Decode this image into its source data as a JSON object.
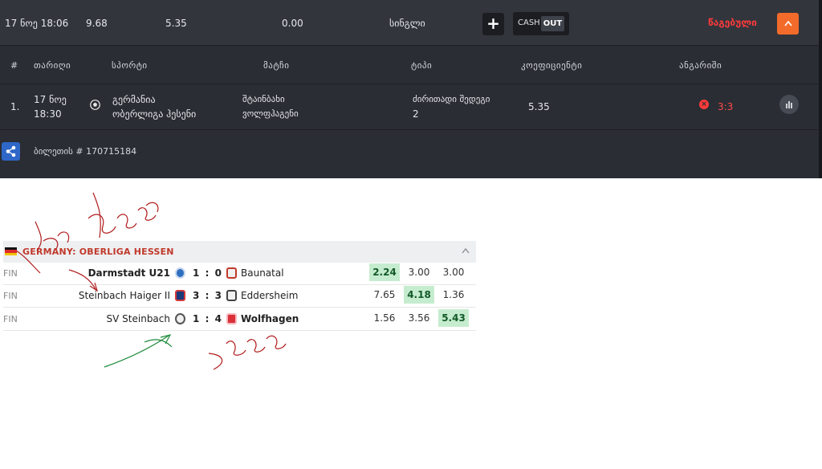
{
  "bet": {
    "summary": {
      "date": "17 ნოე 18:06",
      "stake": "9.68",
      "coefficient": "5.35",
      "payout": "0.00",
      "type": "სინგლი",
      "plus_label": "+",
      "cash_label": "CASH",
      "out_label": "OUT",
      "status": "წაგებული",
      "collapse_label": "^"
    },
    "columns": {
      "num": "#",
      "date": "თარიღი",
      "sport": "სპორტი",
      "match": "მატჩი",
      "type": "ტიპი",
      "coefficient": "კოეფიციენტი",
      "result": "ანგარიში"
    },
    "rows": [
      {
        "num": "1.",
        "date_line1": "17 ნოე",
        "date_line2": "18:30",
        "sport_icon": "soccer-ball-icon",
        "tournament_line1": "გერმანია",
        "tournament_line2": "ობერლიგა ჰესენი",
        "match_line1": "შტაინბახი",
        "match_line2": "ვოლფჰაგენი",
        "type_line1": "ძირითადი შედეგი",
        "type_line2": "2",
        "coefficient": "5.35",
        "result_icon": "lost-x-icon",
        "result": "3:3"
      }
    ],
    "ticket": "ბილეთის # 170715184",
    "colors": {
      "panel": "#2a2d33",
      "accent": "#f36b2a",
      "lost": "#ff3b3b",
      "share": "#2f67c8"
    }
  },
  "results": {
    "league": "GERMANY: OBERLIGA HESSEN",
    "chevron": "^",
    "matches": [
      {
        "status": "FIN",
        "home": "Darmstadt U21",
        "home_score": "1",
        "sep": ":",
        "away_score": "0",
        "away": "Baunatal",
        "odds": [
          "2.24",
          "3.00",
          "3.00"
        ],
        "winner_odd": 0,
        "home_bold": true,
        "away_bold": false
      },
      {
        "status": "FIN",
        "home": "Steinbach Haiger II",
        "home_score": "3",
        "sep": ":",
        "away_score": "3",
        "away": "Eddersheim",
        "odds": [
          "7.65",
          "4.18",
          "1.36"
        ],
        "winner_odd": 1,
        "home_bold": false,
        "away_bold": false
      },
      {
        "status": "FIN",
        "home": "SV Steinbach",
        "home_score": "1",
        "sep": ":",
        "away_score": "4",
        "away": "Wolfhagen",
        "odds": [
          "1.56",
          "3.56",
          "5.43"
        ],
        "winner_odd": 2,
        "home_bold": false,
        "away_bold": true
      }
    ],
    "colors": {
      "win_bg": "#c6eccf",
      "league_text": "#c0392b"
    }
  }
}
